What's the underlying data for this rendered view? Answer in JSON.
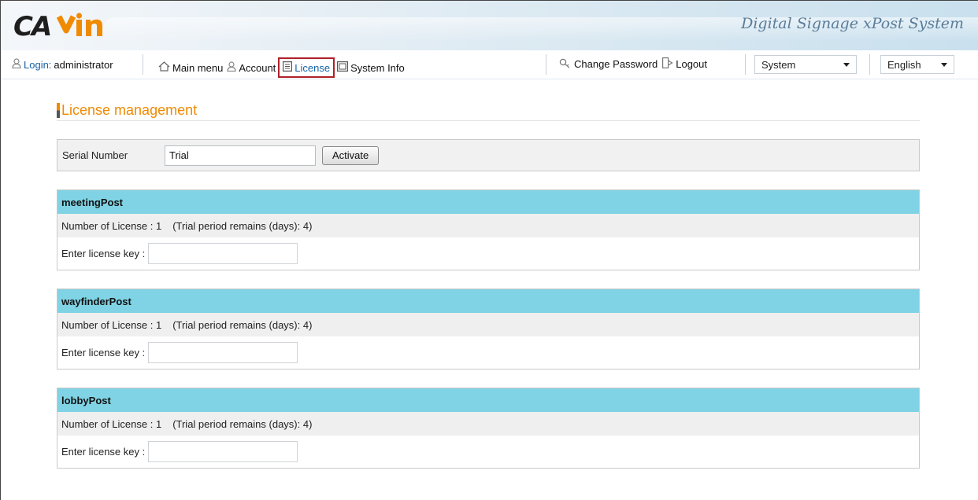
{
  "header": {
    "logo_text": "CAYIN",
    "brand_text": "Digital Signage xPost System"
  },
  "nav": {
    "login_label": "Login:",
    "login_user": "administrator",
    "main_menu": "Main menu",
    "account": "Account",
    "license": "License",
    "system_info": "System Info",
    "change_password": "Change Password",
    "logout": "Logout",
    "system_select": "System",
    "language_select": "English"
  },
  "page": {
    "title": "License management",
    "serial_label": "Serial Number",
    "serial_value": "Trial",
    "activate_label": "Activate"
  },
  "sections": [
    {
      "name": "meetingPost",
      "licenses": "Number of License : 1",
      "trial": "(Trial period remains (days): 4)",
      "key_label": "Enter license key :"
    },
    {
      "name": "wayfinderPost",
      "licenses": "Number of License : 1",
      "trial": "(Trial period remains (days): 4)",
      "key_label": "Enter license key :"
    },
    {
      "name": "lobbyPost",
      "licenses": "Number of License : 1",
      "trial": "(Trial period remains (days): 4)",
      "key_label": "Enter license key :"
    }
  ],
  "colors": {
    "accent": "#f08a00",
    "section_header": "#7fd3e4",
    "link": "#1763a6",
    "highlight": "#b0202a"
  }
}
